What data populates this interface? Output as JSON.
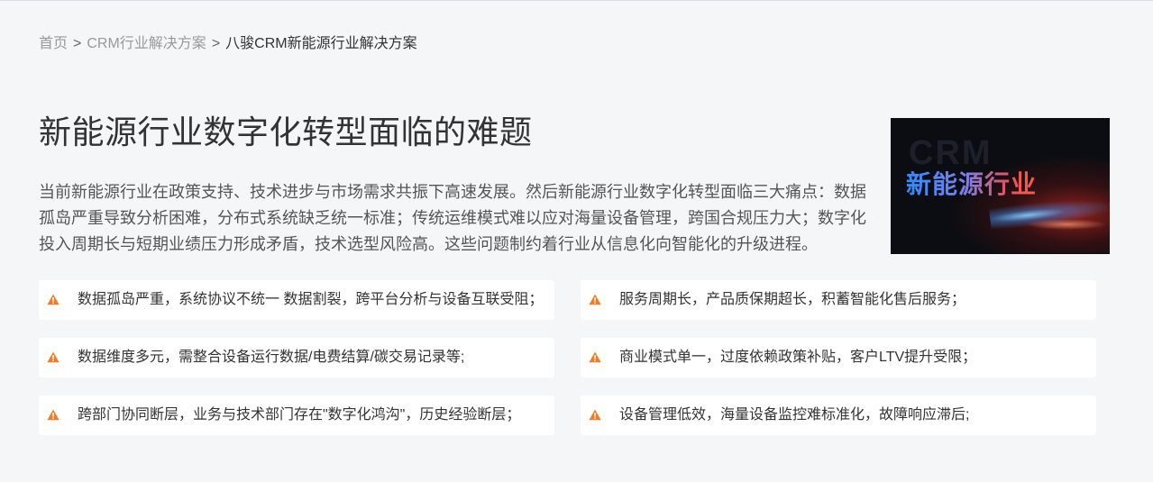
{
  "breadcrumb": {
    "items": [
      {
        "label": "首页"
      },
      {
        "label": "CRM行业解决方案"
      },
      {
        "label": "八骏CRM新能源行业解决方案"
      }
    ],
    "separator": ">"
  },
  "main": {
    "title": "新能源行业数字化转型面临的难题",
    "description": "当前新能源行业在政策支持、技术进步与市场需求共振下高速发展。然后新能源行业数字化转型面临三大痛点：数据孤岛严重导致分析困难，分布式系统缺乏统一标准；传统运维模式难以应对海量设备管理，跨国合规压力大；数字化投入周期长与短期业绩压力形成矛盾，技术选型风险高。这些问题制约着行业从信息化向智能化的升级进程。"
  },
  "hero": {
    "ghost_text": "CRM",
    "text": "新能源行业"
  },
  "problems": [
    {
      "text": "数据孤岛严重，系统协议不统一 数据割裂，跨平台分析与设备互联受阻；"
    },
    {
      "text": "服务周期长，产品质保期超长，积蓄智能化售后服务；"
    },
    {
      "text": "数据维度多元，需整合设备运行数据/电费结算/碳交易记录等;"
    },
    {
      "text": "商业模式单一，过度依赖政策补贴，客户LTV提升受限；"
    },
    {
      "text": "跨部门协同断层，业务与技术部门存在\"数字化鸿沟\"，历史经验断层；"
    },
    {
      "text": "设备管理低效，海量设备监控难标准化，故障响应滞后;"
    }
  ],
  "colors": {
    "accent_warning": "#f47b20",
    "background": "#f5f6f8",
    "card": "#ffffff"
  },
  "icons": {
    "problem": "warning-icon"
  }
}
